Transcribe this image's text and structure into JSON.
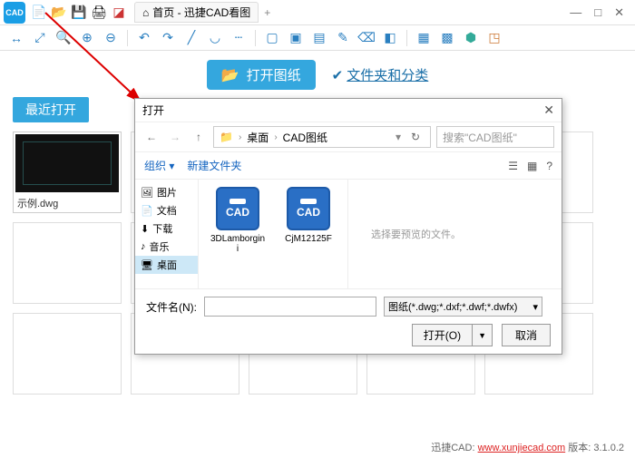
{
  "titlebar": {
    "tab_home_label": "首页 - 迅捷CAD看图",
    "tab_plus": "+",
    "min": "—",
    "max": "□",
    "close": "✕"
  },
  "actions": {
    "open_drawing": "打开图纸",
    "folders_and_categories": "文件夹和分类",
    "check": "✔"
  },
  "recent": {
    "header": "最近打开",
    "sample_filename": "示例.dwg"
  },
  "dialog": {
    "title": "打开",
    "close": "✕",
    "nav": {
      "back": "←",
      "fwd": "→",
      "up": "↑",
      "refresh": "↻"
    },
    "crumb": {
      "desktop": "桌面",
      "folder": "CAD图纸",
      "sep": "›"
    },
    "search_placeholder": "搜索\"CAD图纸\"",
    "organize": "组织 ▾",
    "new_folder": "新建文件夹",
    "view_icons": {
      "list": "☰",
      "grid": "▦",
      "help": "?"
    },
    "tree": [
      {
        "icon": "🖼",
        "label": "图片"
      },
      {
        "icon": "📄",
        "label": "文档"
      },
      {
        "icon": "⬇",
        "label": "下载"
      },
      {
        "icon": "♪",
        "label": "音乐"
      },
      {
        "icon": "🖥",
        "label": "桌面",
        "selected": true
      }
    ],
    "files": [
      {
        "name": "3DLamborgini"
      },
      {
        "name": "CjM12125F"
      }
    ],
    "preview_hint": "选择要预览的文件。",
    "filename_label": "文件名(N):",
    "filetype_label": "图纸(*.dwg;*.dxf;*.dwf;*.dwfx)",
    "open_btn": "打开(O)",
    "cancel_btn": "取消"
  },
  "footer": {
    "prefix": "迅捷CAD:",
    "link": "www.xunjiecad.com",
    "version_label": "版本:",
    "version": "3.1.0.2"
  }
}
